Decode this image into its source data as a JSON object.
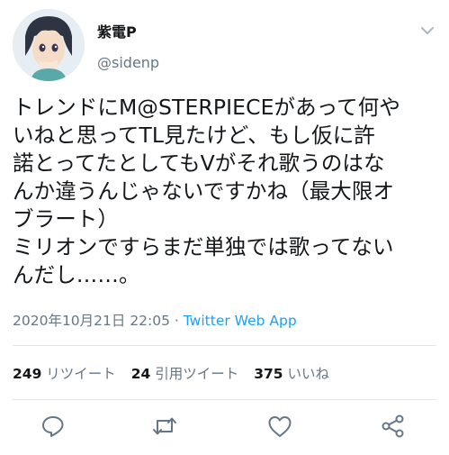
{
  "user": {
    "display_name": "紫電P",
    "handle": "@sidenp",
    "avatar_icon": "anime-character-avatar"
  },
  "tweet": {
    "lines": [
      "トレンドにM@STERPIECEがあって何や",
      "いねと思ってTL見たけど、もし仮に許",
      "諾とってたとしてもVがそれ歌うのはな",
      "んか違うんじゃないですかね（最大限オ",
      "ブラート）",
      "ミリオンですらまだ単独では歌ってない",
      "んだし……。"
    ]
  },
  "meta": {
    "timestamp": "2020年10月21日 22:05",
    "separator": " · ",
    "source": "Twitter Web App"
  },
  "stats": {
    "retweets_count": "249",
    "retweets_label": "リツイート",
    "quotes_count": "24",
    "quotes_label": "引用ツイート",
    "likes_count": "375",
    "likes_label": "いいね"
  },
  "actions": {
    "icons": [
      "reply-icon",
      "retweet-icon",
      "like-icon",
      "share-icon"
    ],
    "icon_color": "#657786"
  },
  "colors": {
    "link": "#1da1f2",
    "secondary": "#657786",
    "divider": "#e1e8ed"
  }
}
